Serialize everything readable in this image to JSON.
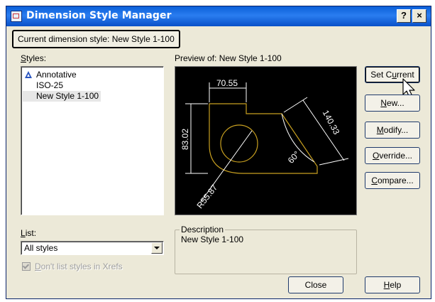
{
  "window": {
    "title": "Dimension Style Manager",
    "help_glyph": "?",
    "close_glyph": "×"
  },
  "current_style": "Current dimension style: New Style 1-100",
  "styles": {
    "label_mnemonic": "S",
    "label_rest": "tyles:",
    "items": [
      {
        "label": "Annotative",
        "icon": "annotative-triangle-icon"
      },
      {
        "label": "ISO-25"
      },
      {
        "label": "New Style 1-100",
        "selected": true
      }
    ]
  },
  "preview": {
    "label": "Preview of: New Style 1-100",
    "dimensions": {
      "top": "70.55",
      "left": "83.02",
      "right": "140.33",
      "angle": "60°",
      "radius": "R55.87"
    },
    "colors": {
      "background": "#000000",
      "geometry": "#c8a020",
      "dimension": "#ffffff"
    }
  },
  "buttons": {
    "set_current": {
      "before": "Set C",
      "mnemonic": "u",
      "after": "rrent"
    },
    "new": {
      "before": "",
      "mnemonic": "N",
      "after": "ew..."
    },
    "modify": {
      "before": "",
      "mnemonic": "M",
      "after": "odify..."
    },
    "override": {
      "before": "",
      "mnemonic": "O",
      "after": "verride..."
    },
    "compare": {
      "before": "",
      "mnemonic": "C",
      "after": "ompare..."
    },
    "close": "Close",
    "help": {
      "before": "",
      "mnemonic": "H",
      "after": "elp"
    }
  },
  "list": {
    "label_mnemonic": "L",
    "label_rest": "ist:",
    "selected": "All styles"
  },
  "xrefs_checkbox": {
    "checked": true,
    "enabled": false,
    "label_mnemonic": "D",
    "label_rest": "on't list styles in Xrefs"
  },
  "description": {
    "title": "Description",
    "value": "New Style 1-100"
  }
}
